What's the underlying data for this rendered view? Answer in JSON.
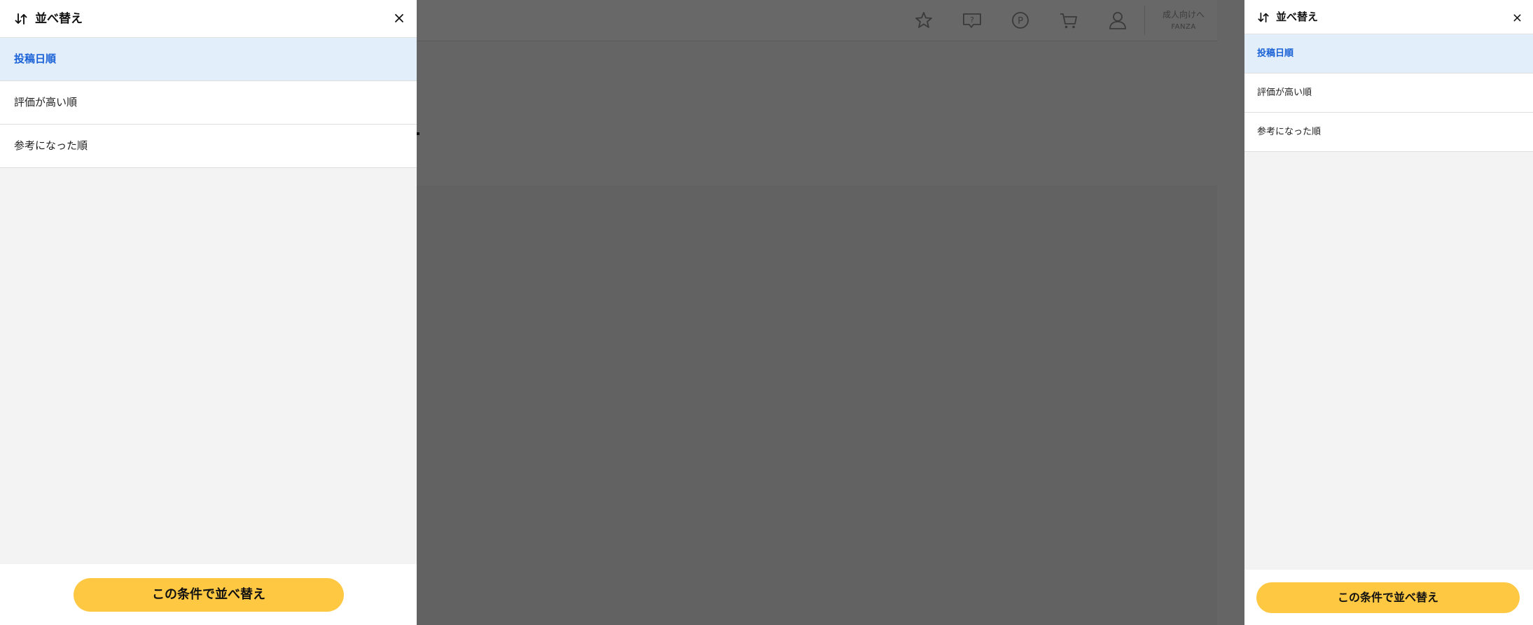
{
  "background_page": {
    "header_icons": [
      "star-icon",
      "help-bubble-icon",
      "points-icon",
      "cart-icon",
      "user-icon"
    ],
    "adult_link": {
      "line1": "成人向けへ",
      "line2": "FANZA"
    }
  },
  "sort_panel_large": {
    "title": "並べ替え",
    "options": [
      {
        "label": "投稿日順",
        "selected": true
      },
      {
        "label": "評価が高い順",
        "selected": false
      },
      {
        "label": "参考になった順",
        "selected": false
      }
    ],
    "apply_label": "この条件で並べ替え"
  },
  "sort_panel_small": {
    "title": "並べ替え",
    "options": [
      {
        "label": "投稿日順",
        "selected": true
      },
      {
        "label": "評価が高い順",
        "selected": false
      },
      {
        "label": "参考になった順",
        "selected": false
      }
    ],
    "apply_label": "この条件で並べ替え"
  },
  "colors": {
    "accent_button": "#ffc843",
    "selected_text": "#1a62d6",
    "selected_bg": "#e3eefb",
    "overlay": "#646464"
  }
}
